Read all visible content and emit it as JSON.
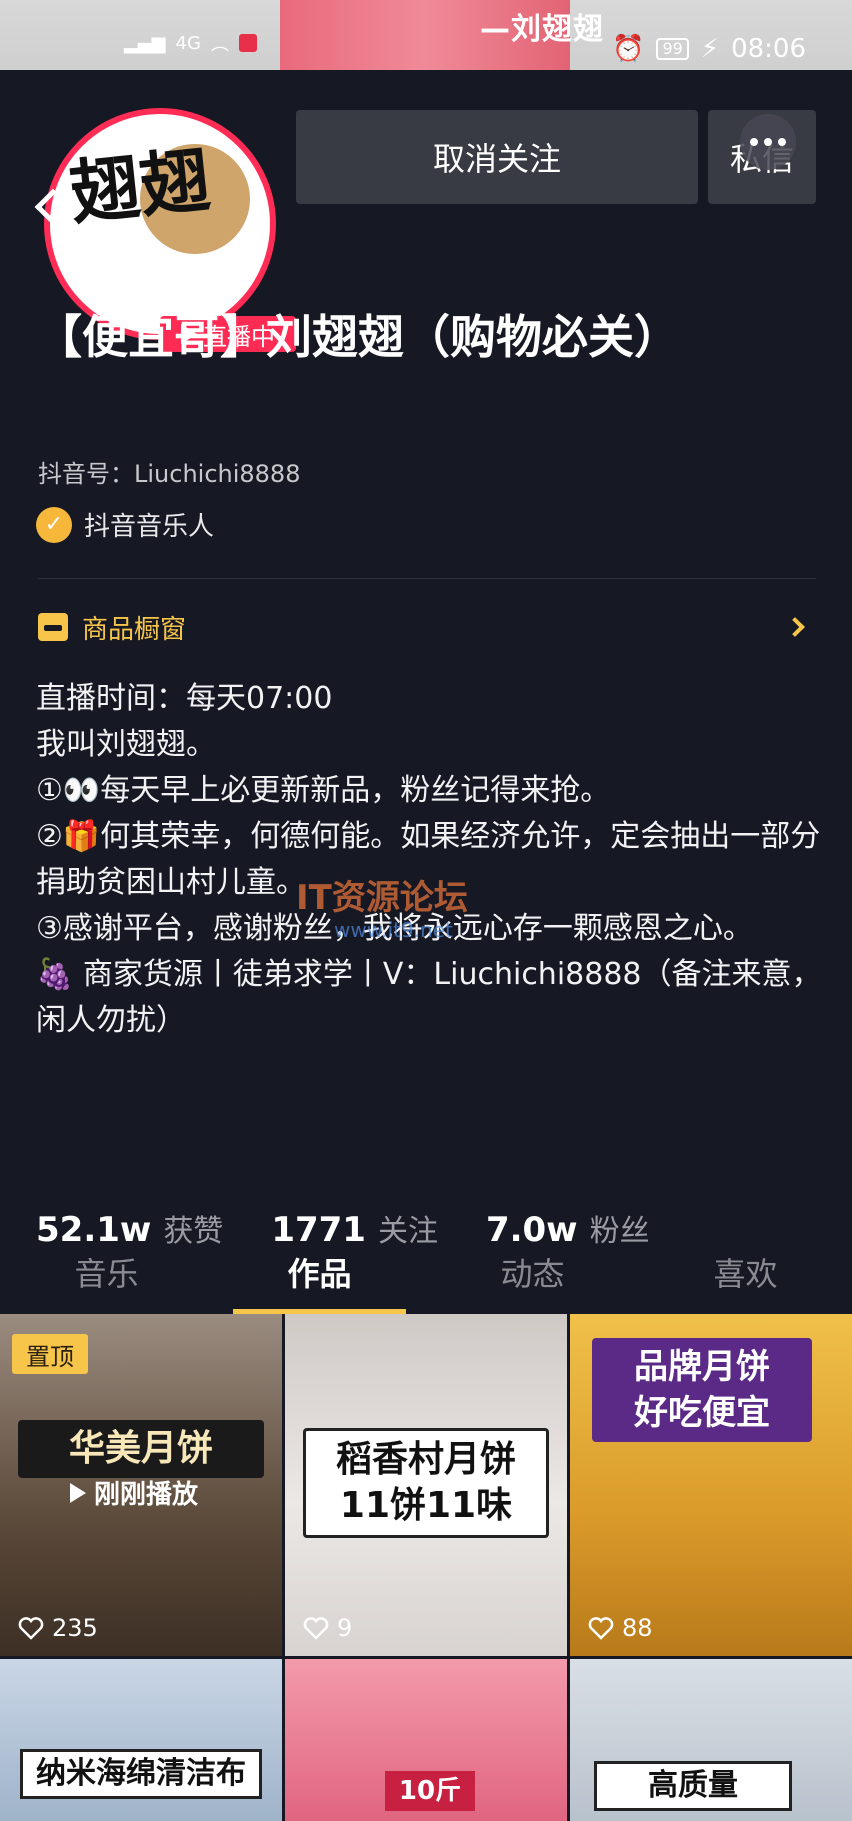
{
  "status_bar": {
    "banner_title": "—刘翅翅",
    "network": "4G",
    "battery": "99",
    "time": "08:06"
  },
  "header": {
    "live_badge": "直播中",
    "unfollow_label": "取消关注",
    "message_label": "私信"
  },
  "profile": {
    "nickname": "【便宜哥】刘翅翅（购物必关）",
    "douyin_id": "抖音号：Liuchichi8888",
    "verification": "抖音音乐人",
    "shop_window": "商品橱窗",
    "bio": "直播时间：每天07:00\n我叫刘翅翅。\n①👀每天早上必更新新品，粉丝记得来抢。\n②🎁何其荣幸，何德何能。如果经济允许，定会抽出一部分捐助贫困山村儿童。\n③感谢平台，感谢粉丝，我将永远心存一颗感恩之心。\n🍇 商家货源丨徒弟求学丨V：Liuchichi8888（备注来意，闲人勿扰）",
    "avatar_text": "翅翅"
  },
  "watermark": {
    "text": "IT资源论坛",
    "sub": "www.it9.net"
  },
  "stats": [
    {
      "value": "52.1w",
      "label": "获赞"
    },
    {
      "value": "1771",
      "label": "关注"
    },
    {
      "value": "7.0w",
      "label": "粉丝"
    }
  ],
  "tabs": [
    {
      "label": "音乐",
      "active": false
    },
    {
      "label": "作品",
      "active": true
    },
    {
      "label": "动态",
      "active": false
    },
    {
      "label": "喜欢",
      "active": false
    }
  ],
  "videos": [
    {
      "pinned": "置顶",
      "title": "华美月饼",
      "status": "刚刚播放",
      "likes": "235"
    },
    {
      "title": "稻香村月饼\n11饼11味",
      "likes": "9"
    },
    {
      "title": "品牌月饼\n好吃便宜",
      "likes": "88"
    },
    {
      "title": "纳米海绵清洁布"
    },
    {
      "title": "10斤"
    },
    {
      "title": "高质量"
    }
  ]
}
